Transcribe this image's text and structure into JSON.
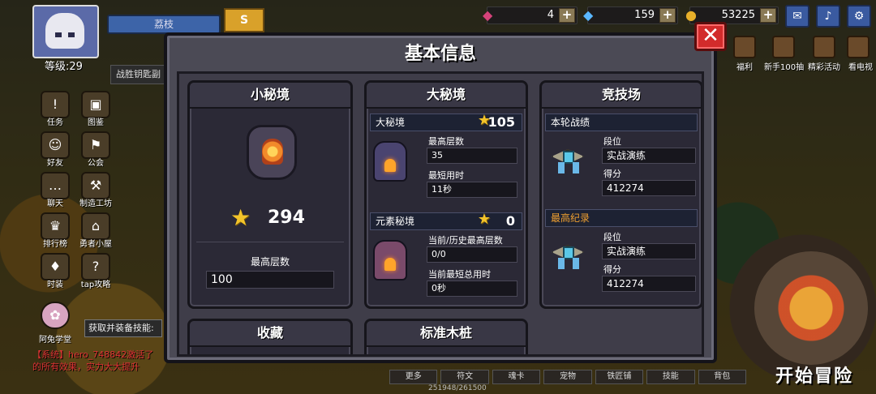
{
  "player": {
    "name": "荔枝",
    "level": "等级:29",
    "battle_key_text": "战胜钥匙副"
  },
  "currencies": [
    {
      "icon": "pink-gem-icon",
      "value": "4",
      "color": "#d6437a"
    },
    {
      "icon": "blue-diamond-icon",
      "value": "159",
      "color": "#5ab8ff"
    },
    {
      "icon": "gold-coin-icon",
      "value": "53225",
      "color": "#e8b02a"
    }
  ],
  "top_right_icons": [
    "mail-icon",
    "speaker-icon",
    "settings-gear-icon"
  ],
  "right_menu": [
    {
      "label": "福利",
      "icon": "welfare-icon"
    },
    {
      "label": "新手100抽",
      "icon": "newbie-draw-icon"
    },
    {
      "label": "精彩活动",
      "icon": "event-icon"
    },
    {
      "label": "看电视",
      "icon": "tv-icon"
    }
  ],
  "left_menu": [
    {
      "label": "任务",
      "icon": "quest-icon"
    },
    {
      "label": "图鉴",
      "icon": "codex-icon"
    },
    {
      "label": "好友",
      "icon": "friends-icon"
    },
    {
      "label": "公会",
      "icon": "guild-icon"
    },
    {
      "label": "聊天",
      "icon": "chat-icon"
    },
    {
      "label": "制造工坊",
      "icon": "workshop-icon"
    },
    {
      "label": "排行榜",
      "icon": "ranking-icon"
    },
    {
      "label": "勇者小屋",
      "icon": "hero-house-icon"
    },
    {
      "label": "时装",
      "icon": "fashion-icon"
    },
    {
      "label": "tap攻略",
      "icon": "tap-guide-icon"
    },
    {
      "label": "阿兔学堂",
      "icon": "rabbit-school-icon"
    }
  ],
  "skill_tip": "获取并装备技能:",
  "chat": {
    "line1": "【系统】hero_748842激活了",
    "line2": "的所有效果，实力大大提升"
  },
  "exp": "251948/261500",
  "bottom_tabs": [
    "更多",
    "符文",
    "魂卡",
    "宠物",
    "铁匠铺",
    "技能",
    "背包"
  ],
  "start_button": "开始冒险",
  "modal": {
    "title": "基本信息",
    "close_symbol": "✕",
    "small_realm": {
      "title": "小秘境",
      "star_count": "294",
      "max_floor_label": "最高层数",
      "max_floor_value": "100"
    },
    "big_realm": {
      "title": "大秘境",
      "section1": {
        "name": "大秘境",
        "stars": "105",
        "field1_label": "最高层数",
        "field1_value": "35",
        "field2_label": "最短用时",
        "field2_value": "11秒"
      },
      "section2": {
        "name": "元素秘境",
        "stars": "0",
        "field1_label": "当前/历史最高层数",
        "field1_value": "0/0",
        "field2_label": "当前最短总用时",
        "field2_value": "0秒"
      }
    },
    "arena": {
      "title": "竞技场",
      "current": {
        "header": "本轮战绩",
        "rank_label": "段位",
        "rank_value": "实战演练",
        "score_label": "得分",
        "score_value": "412274"
      },
      "best": {
        "header": "最高纪录",
        "header_color": "#f0a030",
        "rank_label": "段位",
        "rank_value": "实战演练",
        "score_label": "得分",
        "score_value": "412274"
      }
    },
    "collection": {
      "title": "收藏"
    },
    "wooden_dummy": {
      "title": "标准木桩"
    }
  }
}
